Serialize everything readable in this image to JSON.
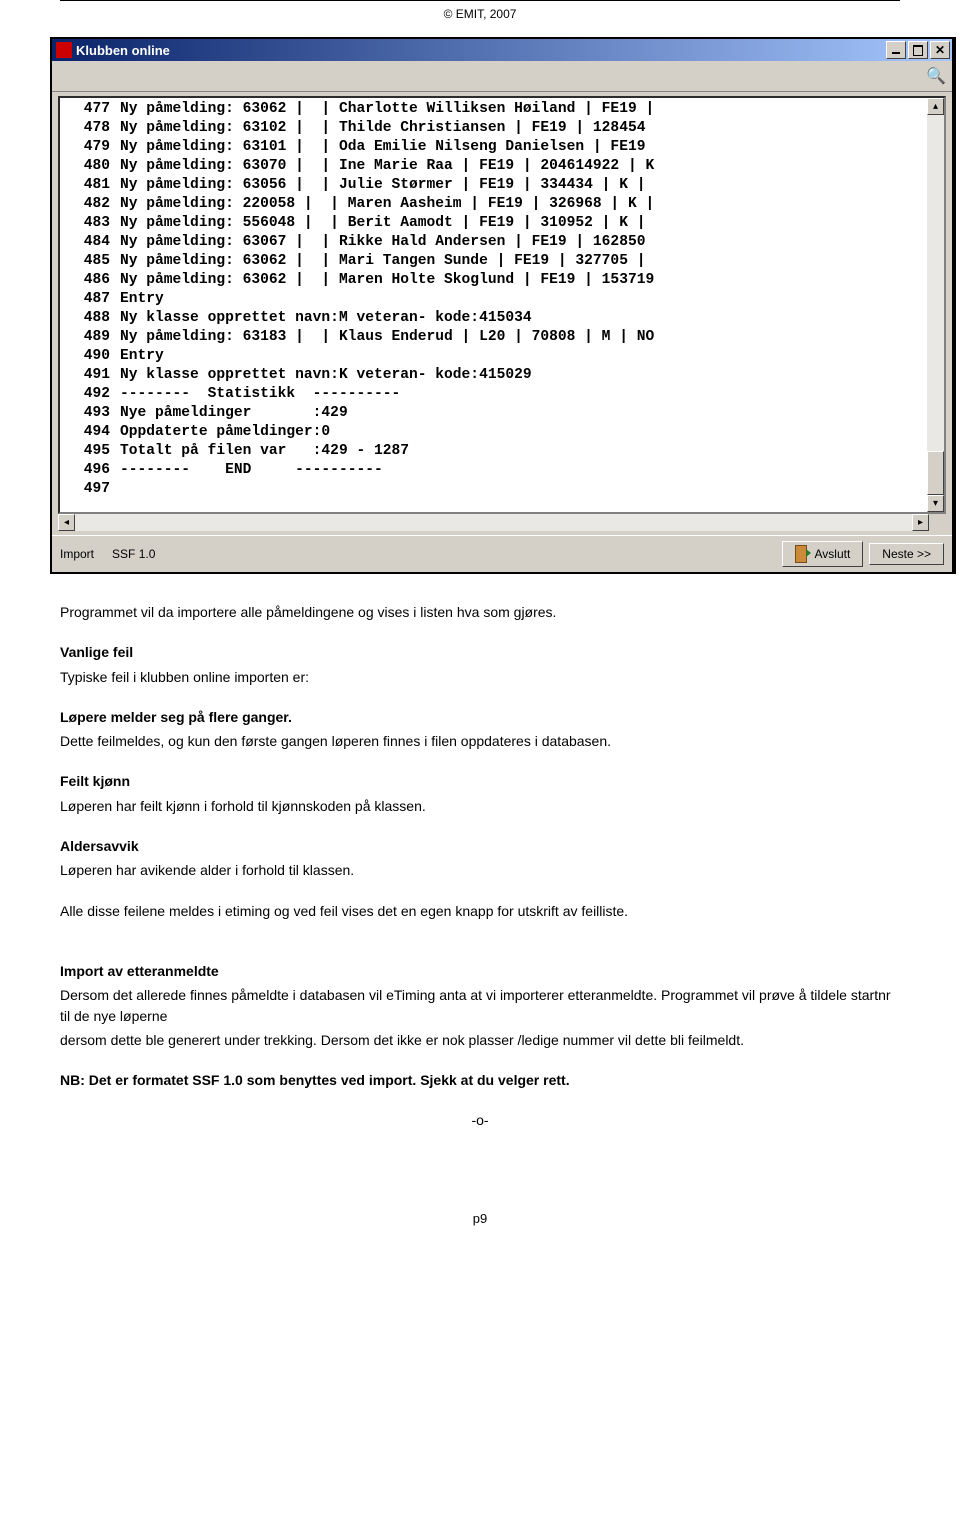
{
  "header": "© EMIT, 2007",
  "window": {
    "title": "Klubben online",
    "buttons_tooltip": {
      "min": "Minimize",
      "max": "Maximize",
      "close": "Close"
    },
    "log_lines": [
      {
        "n": "477",
        "t": "Ny påmelding: 63062 |  | Charlotte Williksen Høiland | FE19 |"
      },
      {
        "n": "478",
        "t": "Ny påmelding: 63102 |  | Thilde Christiansen | FE19 | 128454"
      },
      {
        "n": "479",
        "t": "Ny påmelding: 63101 |  | Oda Emilie Nilseng Danielsen | FE19"
      },
      {
        "n": "480",
        "t": "Ny påmelding: 63070 |  | Ine Marie Raa | FE19 | 204614922 | K"
      },
      {
        "n": "481",
        "t": "Ny påmelding: 63056 |  | Julie Størmer | FE19 | 334434 | K |"
      },
      {
        "n": "482",
        "t": "Ny påmelding: 220058 |  | Maren Aasheim | FE19 | 326968 | K |"
      },
      {
        "n": "483",
        "t": "Ny påmelding: 556048 |  | Berit Aamodt | FE19 | 310952 | K |"
      },
      {
        "n": "484",
        "t": "Ny påmelding: 63067 |  | Rikke Hald Andersen | FE19 | 162850"
      },
      {
        "n": "485",
        "t": "Ny påmelding: 63062 |  | Mari Tangen Sunde | FE19 | 327705 |"
      },
      {
        "n": "486",
        "t": "Ny påmelding: 63062 |  | Maren Holte Skoglund | FE19 | 153719"
      },
      {
        "n": "487",
        "t": "Entry"
      },
      {
        "n": "488",
        "t": "Ny klasse opprettet navn:M veteran- kode:415034"
      },
      {
        "n": "489",
        "t": "Ny påmelding: 63183 |  | Klaus Enderud | L20 | 70808 | M | NO"
      },
      {
        "n": "490",
        "t": "Entry"
      },
      {
        "n": "491",
        "t": "Ny klasse opprettet navn:K veteran- kode:415029"
      },
      {
        "n": "492",
        "t": "--------  Statistikk  ----------"
      },
      {
        "n": "493",
        "t": "Nye påmeldinger       :429"
      },
      {
        "n": "494",
        "t": "Oppdaterte påmeldinger:0"
      },
      {
        "n": "495",
        "t": "Totalt på filen var   :429 - 1287"
      },
      {
        "n": "496",
        "t": "--------    END     ----------"
      },
      {
        "n": "497",
        "t": ""
      }
    ],
    "status": {
      "import": "Import",
      "ssf": "SSF 1.0",
      "avslutt": "Avslutt",
      "neste": "Neste >>"
    }
  },
  "doc": {
    "p1": "Programmet vil da importere alle påmeldingene og vises i listen hva som  gjøres.",
    "vanlige_feil_h": "Vanlige feil",
    "vanlige_feil_t": "Typiske feil i klubben online importen er:",
    "lopere_h": "Løpere melder seg på flere ganger.",
    "lopere_t": "Dette feilmeldes, og kun den første gangen løperen finnes i filen oppdateres i databasen.",
    "feilt_h": "Feilt kjønn",
    "feilt_t": "Løperen har feilt kjønn i forhold til kjønnskoden på klassen.",
    "alder_h": "Aldersavvik",
    "alder_t": "Løperen har avikende alder i forhold til klassen.",
    "alle_disse": "Alle disse feilene meldes i etiming og ved feil vises det en egen knapp for utskrift av feilliste.",
    "import_h": "Import av etteranmeldte",
    "import_t1": "Dersom det allerede finnes påmeldte i databasen vil eTiming anta at vi importerer etteranmeldte. Programmet vil prøve å tildele startnr til de nye løperne",
    "import_t2": "dersom dette ble generert under trekking.  Dersom det ikke er nok plasser /ledige nummer vil dette bli feilmeldt.",
    "nb": "NB: Det er formatet SSF 1.0 som benyttes ved import. Sjekk at du velger rett.",
    "end": "-o-"
  },
  "footer": "p9"
}
